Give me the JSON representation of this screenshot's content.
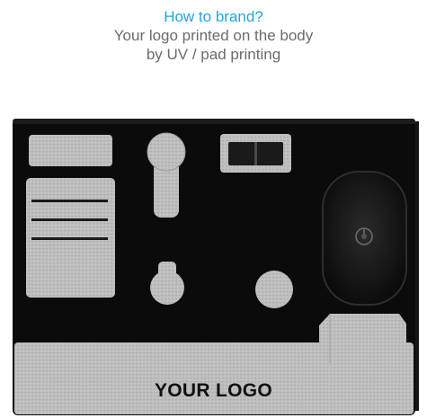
{
  "heading": {
    "question": "How to brand?",
    "line1": "Your logo printed on the body",
    "line2": "by UV / pad printing"
  },
  "product": {
    "logo_text": "YOUR LOGO"
  },
  "icons": {
    "charging_pad": "power-icon"
  },
  "colors": {
    "accent": "#1ea6dc",
    "body_text": "#6b6b6b",
    "case_black": "#0b0b0b",
    "felt_gray": "#b9b9b9"
  }
}
